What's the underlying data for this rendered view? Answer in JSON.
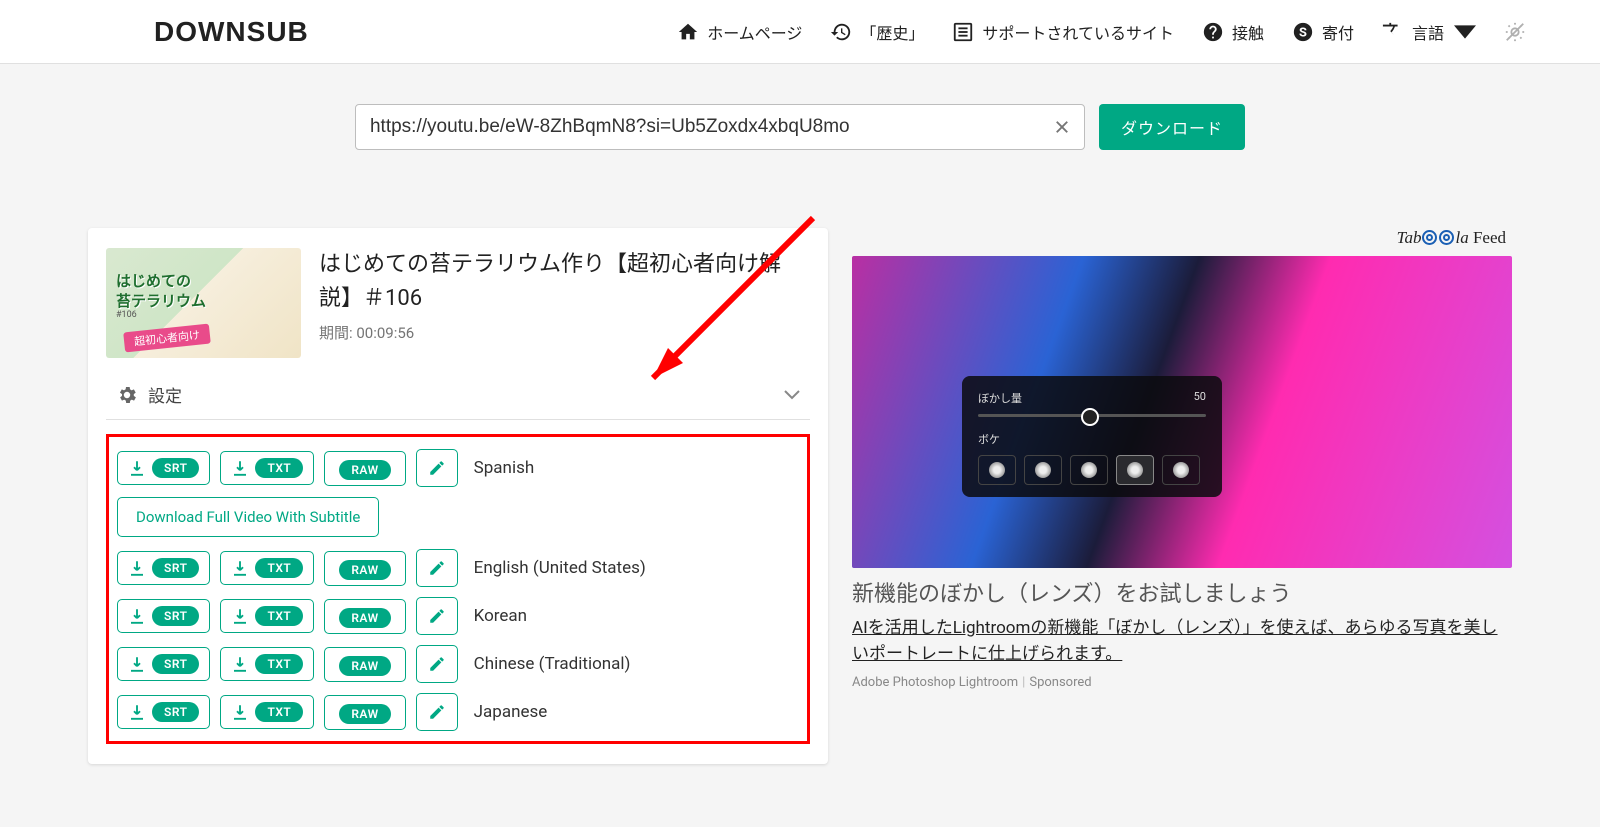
{
  "logo": "DOWNSUB",
  "nav": {
    "home": "ホームページ",
    "history": "「歴史」",
    "sites": "サポートされているサイト",
    "contact": "接触",
    "donate": "寄付",
    "language": "言語"
  },
  "search": {
    "value": "https://youtu.be/eW-8ZhBqmN8?si=Ub5Zoxdx4xbqU8mo",
    "download": "ダウンロード"
  },
  "video": {
    "thumb_line1": "はじめての",
    "thumb_line2": "苔テラリウム",
    "thumb_tag": "超初心者向け",
    "thumb_num": "#106",
    "title": "はじめての苔テラリウム作り【超初心者向け解説】＃106",
    "duration_label": "期間:",
    "duration_value": "00:09:56",
    "settings": "設定"
  },
  "buttons": {
    "srt": "SRT",
    "txt": "TXT",
    "raw": "RAW",
    "full": "Download Full Video With Subtitle"
  },
  "langs": {
    "0": "Spanish",
    "1": "English (United States)",
    "2": "Korean",
    "3": "Chinese (Traditional)",
    "4": "Japanese"
  },
  "sidebar": {
    "taboola_prefix": "Tab",
    "taboola_suffix": "la",
    "feed": " Feed",
    "ad_panel_label": "ぼかし量",
    "ad_panel_value": "50",
    "ad_panel_sub": "ボケ",
    "ad_title": "新機能のぼかし（レンズ）をお試しましょう",
    "ad_desc": "AIを活用したLightroomの新機能「ぼかし（レンズ）」を使えば、あらゆる写真を美しいポートレートに仕上げられます。",
    "ad_brand": "Adobe Photoshop Lightroom",
    "ad_sponsored": "Sponsored"
  }
}
